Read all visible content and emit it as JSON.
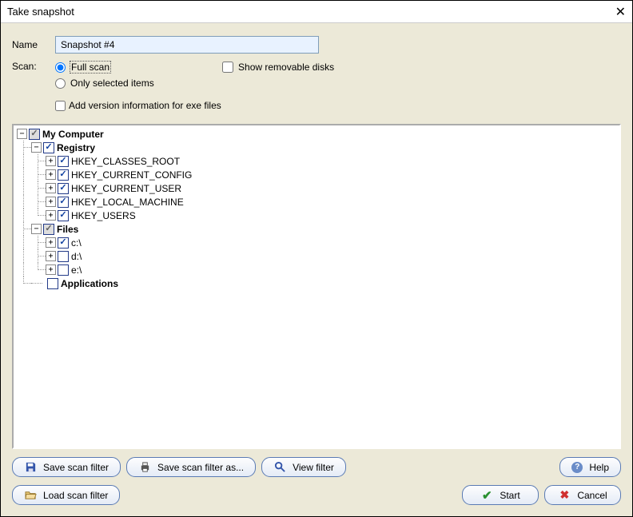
{
  "window": {
    "title": "Take snapshot"
  },
  "form": {
    "name_label": "Name",
    "name_value": "Snapshot #4",
    "scan_label": "Scan:",
    "radio_full": "Full scan",
    "radio_selected": "Only selected items",
    "show_removable": "Show removable disks",
    "add_version": "Add version information for exe files",
    "radio_value": "full",
    "show_removable_checked": false,
    "add_version_checked": false
  },
  "tree": {
    "my_computer": "My Computer",
    "registry": "Registry",
    "hk_root": "HKEY_CLASSES_ROOT",
    "hk_config": "HKEY_CURRENT_CONFIG",
    "hk_user": "HKEY_CURRENT_USER",
    "hk_local": "HKEY_LOCAL_MACHINE",
    "hk_users": "HKEY_USERS",
    "files": "Files",
    "drive_c": "c:\\",
    "drive_d": "d:\\",
    "drive_e": "e:\\",
    "applications": "Applications"
  },
  "buttons": {
    "save_filter": "Save scan filter",
    "save_filter_as": "Save scan filter as...",
    "view_filter": "View filter",
    "help": "Help",
    "load_filter": "Load scan filter",
    "start": "Start",
    "cancel": "Cancel"
  }
}
